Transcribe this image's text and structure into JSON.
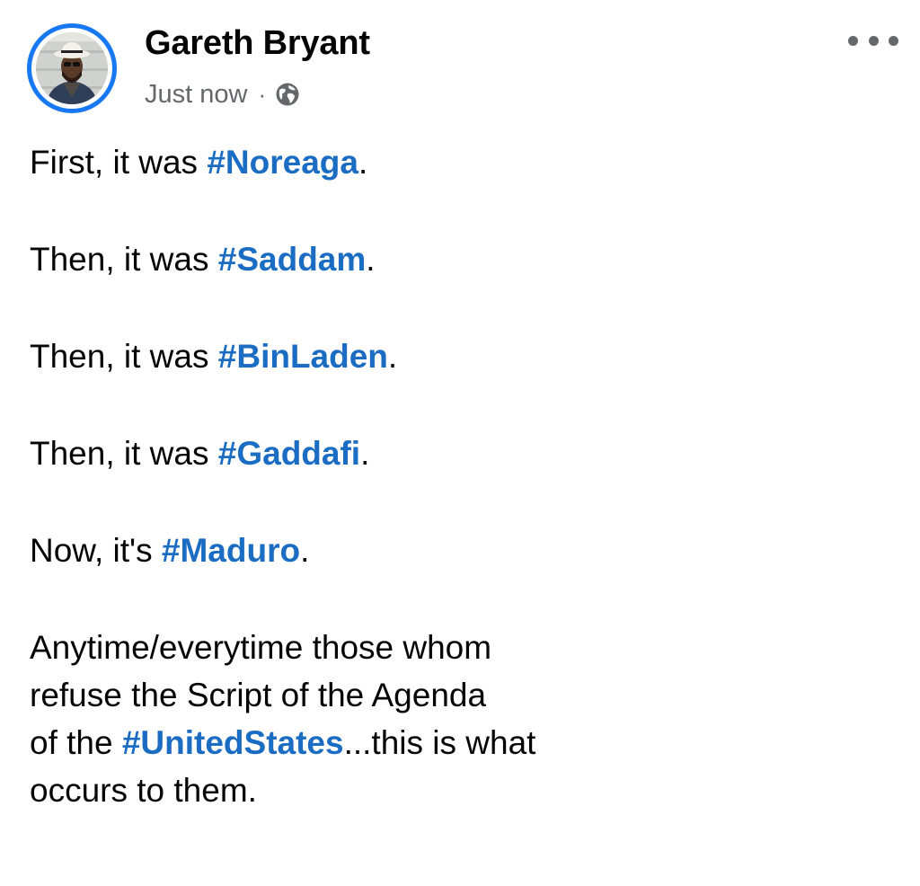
{
  "post": {
    "author": "Gareth Bryant",
    "timestamp": "Just now",
    "separator": "·",
    "privacy_icon": "globe-icon",
    "more_icon": "more-options-icon"
  },
  "body": {
    "line1": {
      "prefix": "First, it was ",
      "hashtag": "#Noreaga",
      "suffix": "."
    },
    "line2": {
      "prefix": "Then, it was ",
      "hashtag": "#Saddam",
      "suffix": "."
    },
    "line3": {
      "prefix": "Then, it was ",
      "hashtag": "#BinLaden",
      "suffix": "."
    },
    "line4": {
      "prefix": "Then, it was ",
      "hashtag": "#Gaddafi",
      "suffix": "."
    },
    "line5": {
      "prefix": "Now, it's ",
      "hashtag": "#Maduro",
      "suffix": "."
    },
    "closing": {
      "text1": "Anytime/everytime those whom\nrefuse the Script of the Agenda\nof the ",
      "hashtag": "#UnitedStates",
      "text2": "...this is what\noccurs to them."
    }
  },
  "colors": {
    "hashtag": "#1b6cc3",
    "avatar_ring": "#1877f2",
    "secondary_text": "#65676b",
    "primary_text": "#050505"
  }
}
